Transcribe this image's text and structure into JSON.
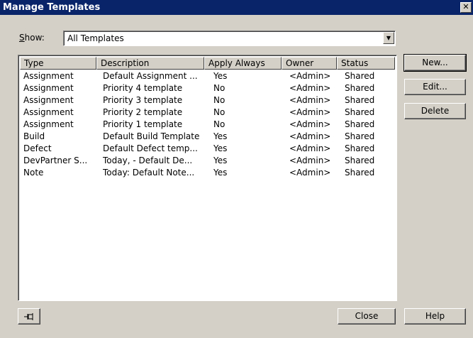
{
  "window": {
    "title": "Manage Templates",
    "close_glyph": "✕"
  },
  "show": {
    "label_prefix": "S",
    "label_rest": "how:",
    "value": "All Templates"
  },
  "table": {
    "columns": [
      "Type",
      "Description",
      "Apply Always",
      "Owner",
      "Status"
    ],
    "rows": [
      [
        "Assignment",
        "Default Assignment ...",
        "Yes",
        "<Admin>",
        "Shared"
      ],
      [
        "Assignment",
        "Priority 4 template",
        "No",
        "<Admin>",
        "Shared"
      ],
      [
        "Assignment",
        "Priority 3 template",
        "No",
        "<Admin>",
        "Shared"
      ],
      [
        "Assignment",
        "Priority 2 template",
        "No",
        "<Admin>",
        "Shared"
      ],
      [
        "Assignment",
        "Priority 1 template",
        "No",
        "<Admin>",
        "Shared"
      ],
      [
        "Build",
        "Default Build Template",
        "Yes",
        "<Admin>",
        "Shared"
      ],
      [
        "Defect",
        "Default Defect temp...",
        "Yes",
        "<Admin>",
        "Shared"
      ],
      [
        "DevPartner S...",
        "Today,  - Default De...",
        "Yes",
        "<Admin>",
        "Shared"
      ],
      [
        "Note",
        "Today: Default Note...",
        "Yes",
        "<Admin>",
        "Shared"
      ]
    ]
  },
  "buttons": {
    "new": "New...",
    "edit": "Edit...",
    "delete": "Delete",
    "close": "Close",
    "help": "Help"
  },
  "icons": {
    "pin": "pin-icon"
  }
}
